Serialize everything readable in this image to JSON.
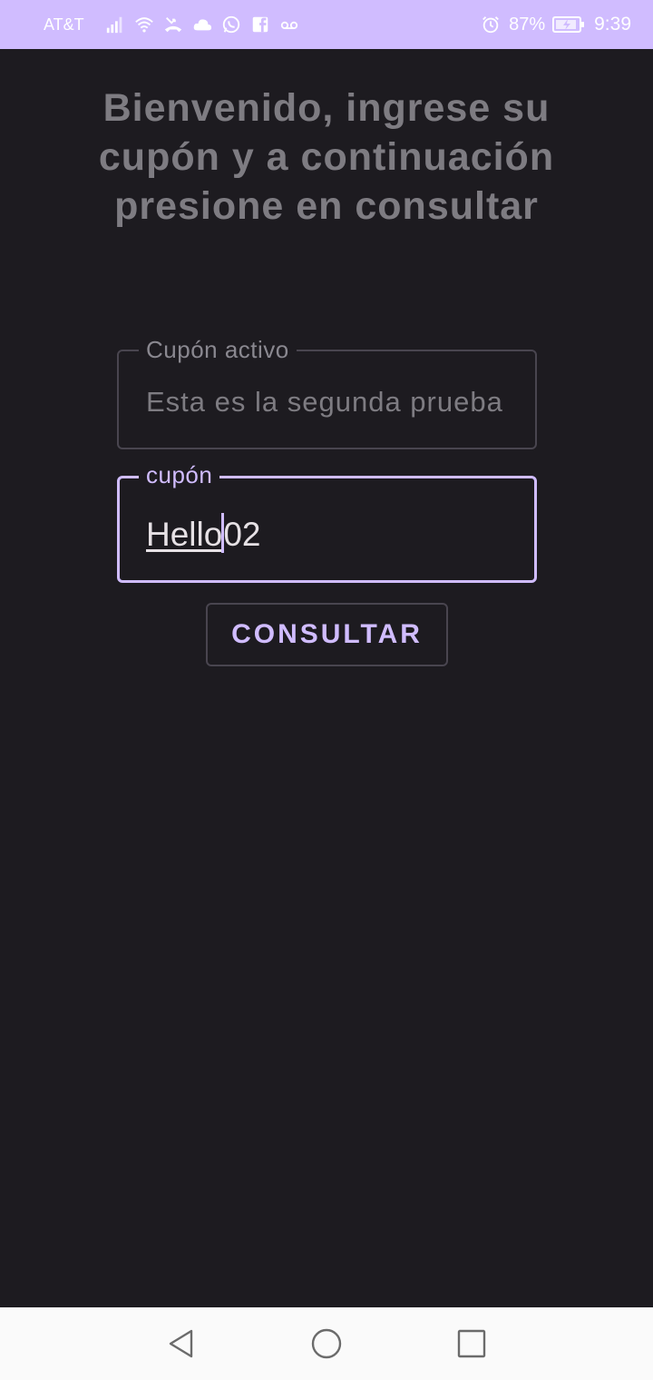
{
  "status_bar": {
    "carrier": "AT&T",
    "battery_percent": "87%",
    "time": "9:39",
    "left_icons": [
      "signal-icon",
      "wifi-icon",
      "missed-call-icon",
      "cloud-icon",
      "whatsapp-icon",
      "facebook-icon",
      "voicemail-icon"
    ],
    "right_icons": [
      "alarm-icon",
      "battery-icon"
    ]
  },
  "main": {
    "welcome_text": "Bienvenido, ingrese su cupón y a continuación presione en consultar",
    "active_coupon": {
      "label": "Cupón activo",
      "value": "Esta es la segunda prueba"
    },
    "coupon_input": {
      "label": "cupón",
      "value_before_cursor": "Hello",
      "value_after_cursor": "02"
    },
    "consultar_button": "CONSULTAR"
  },
  "nav_bar": {
    "buttons": [
      "back-icon",
      "home-icon",
      "recents-icon"
    ]
  },
  "colors": {
    "accent": "#d0bcff",
    "background": "#1d1b20",
    "outline": "#49454f",
    "muted_text": "#7e7c82"
  }
}
